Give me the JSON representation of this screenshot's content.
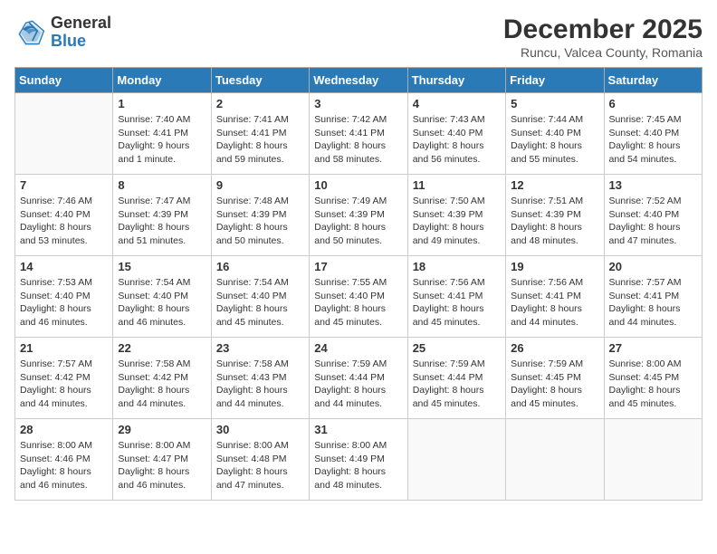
{
  "header": {
    "logo_general": "General",
    "logo_blue": "Blue",
    "month_title": "December 2025",
    "location": "Runcu, Valcea County, Romania"
  },
  "weekdays": [
    "Sunday",
    "Monday",
    "Tuesday",
    "Wednesday",
    "Thursday",
    "Friday",
    "Saturday"
  ],
  "weeks": [
    [
      {
        "day": "",
        "info": ""
      },
      {
        "day": "1",
        "info": "Sunrise: 7:40 AM\nSunset: 4:41 PM\nDaylight: 9 hours\nand 1 minute."
      },
      {
        "day": "2",
        "info": "Sunrise: 7:41 AM\nSunset: 4:41 PM\nDaylight: 8 hours\nand 59 minutes."
      },
      {
        "day": "3",
        "info": "Sunrise: 7:42 AM\nSunset: 4:41 PM\nDaylight: 8 hours\nand 58 minutes."
      },
      {
        "day": "4",
        "info": "Sunrise: 7:43 AM\nSunset: 4:40 PM\nDaylight: 8 hours\nand 56 minutes."
      },
      {
        "day": "5",
        "info": "Sunrise: 7:44 AM\nSunset: 4:40 PM\nDaylight: 8 hours\nand 55 minutes."
      },
      {
        "day": "6",
        "info": "Sunrise: 7:45 AM\nSunset: 4:40 PM\nDaylight: 8 hours\nand 54 minutes."
      }
    ],
    [
      {
        "day": "7",
        "info": "Sunrise: 7:46 AM\nSunset: 4:40 PM\nDaylight: 8 hours\nand 53 minutes."
      },
      {
        "day": "8",
        "info": "Sunrise: 7:47 AM\nSunset: 4:39 PM\nDaylight: 8 hours\nand 51 minutes."
      },
      {
        "day": "9",
        "info": "Sunrise: 7:48 AM\nSunset: 4:39 PM\nDaylight: 8 hours\nand 50 minutes."
      },
      {
        "day": "10",
        "info": "Sunrise: 7:49 AM\nSunset: 4:39 PM\nDaylight: 8 hours\nand 50 minutes."
      },
      {
        "day": "11",
        "info": "Sunrise: 7:50 AM\nSunset: 4:39 PM\nDaylight: 8 hours\nand 49 minutes."
      },
      {
        "day": "12",
        "info": "Sunrise: 7:51 AM\nSunset: 4:39 PM\nDaylight: 8 hours\nand 48 minutes."
      },
      {
        "day": "13",
        "info": "Sunrise: 7:52 AM\nSunset: 4:40 PM\nDaylight: 8 hours\nand 47 minutes."
      }
    ],
    [
      {
        "day": "14",
        "info": "Sunrise: 7:53 AM\nSunset: 4:40 PM\nDaylight: 8 hours\nand 46 minutes."
      },
      {
        "day": "15",
        "info": "Sunrise: 7:54 AM\nSunset: 4:40 PM\nDaylight: 8 hours\nand 46 minutes."
      },
      {
        "day": "16",
        "info": "Sunrise: 7:54 AM\nSunset: 4:40 PM\nDaylight: 8 hours\nand 45 minutes."
      },
      {
        "day": "17",
        "info": "Sunrise: 7:55 AM\nSunset: 4:40 PM\nDaylight: 8 hours\nand 45 minutes."
      },
      {
        "day": "18",
        "info": "Sunrise: 7:56 AM\nSunset: 4:41 PM\nDaylight: 8 hours\nand 45 minutes."
      },
      {
        "day": "19",
        "info": "Sunrise: 7:56 AM\nSunset: 4:41 PM\nDaylight: 8 hours\nand 44 minutes."
      },
      {
        "day": "20",
        "info": "Sunrise: 7:57 AM\nSunset: 4:41 PM\nDaylight: 8 hours\nand 44 minutes."
      }
    ],
    [
      {
        "day": "21",
        "info": "Sunrise: 7:57 AM\nSunset: 4:42 PM\nDaylight: 8 hours\nand 44 minutes."
      },
      {
        "day": "22",
        "info": "Sunrise: 7:58 AM\nSunset: 4:42 PM\nDaylight: 8 hours\nand 44 minutes."
      },
      {
        "day": "23",
        "info": "Sunrise: 7:58 AM\nSunset: 4:43 PM\nDaylight: 8 hours\nand 44 minutes."
      },
      {
        "day": "24",
        "info": "Sunrise: 7:59 AM\nSunset: 4:44 PM\nDaylight: 8 hours\nand 44 minutes."
      },
      {
        "day": "25",
        "info": "Sunrise: 7:59 AM\nSunset: 4:44 PM\nDaylight: 8 hours\nand 45 minutes."
      },
      {
        "day": "26",
        "info": "Sunrise: 7:59 AM\nSunset: 4:45 PM\nDaylight: 8 hours\nand 45 minutes."
      },
      {
        "day": "27",
        "info": "Sunrise: 8:00 AM\nSunset: 4:45 PM\nDaylight: 8 hours\nand 45 minutes."
      }
    ],
    [
      {
        "day": "28",
        "info": "Sunrise: 8:00 AM\nSunset: 4:46 PM\nDaylight: 8 hours\nand 46 minutes."
      },
      {
        "day": "29",
        "info": "Sunrise: 8:00 AM\nSunset: 4:47 PM\nDaylight: 8 hours\nand 46 minutes."
      },
      {
        "day": "30",
        "info": "Sunrise: 8:00 AM\nSunset: 4:48 PM\nDaylight: 8 hours\nand 47 minutes."
      },
      {
        "day": "31",
        "info": "Sunrise: 8:00 AM\nSunset: 4:49 PM\nDaylight: 8 hours\nand 48 minutes."
      },
      {
        "day": "",
        "info": ""
      },
      {
        "day": "",
        "info": ""
      },
      {
        "day": "",
        "info": ""
      }
    ]
  ]
}
